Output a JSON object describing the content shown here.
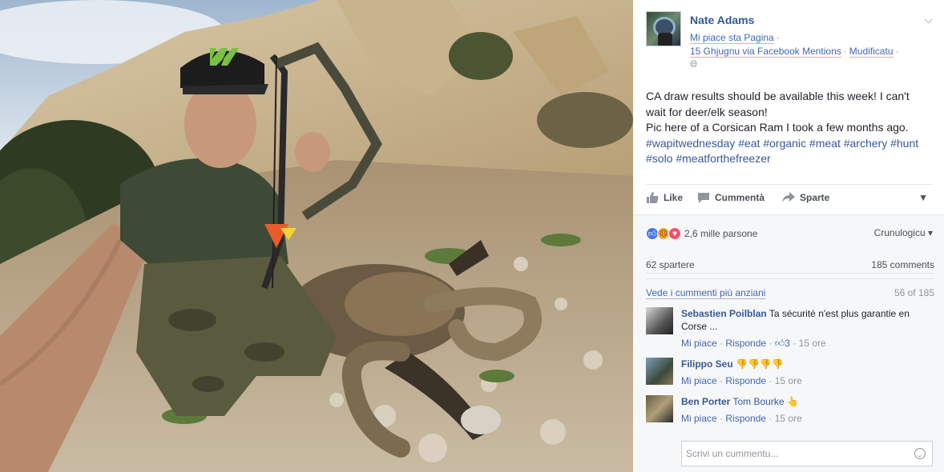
{
  "post": {
    "page_name": "Nate Adams",
    "liked_page": "Mi piace sta Pagina",
    "date_via": "15 Ghjugnu via Facebook Mentions",
    "edited": "Mudificatu",
    "text_lines": [
      "CA draw results should be available this week! I can't wait for deer/elk season!",
      "Pic here of a Corsican Ram I took a few months ago."
    ],
    "hashtags": [
      "#wapitwednesday",
      "#eat",
      "#organic",
      "#meat",
      "#archery",
      "#hunt",
      "#solo",
      "#meatforthefreezer"
    ]
  },
  "actions": {
    "like": "Like",
    "comment": "Cummentà",
    "share": "Sparte"
  },
  "reactions": {
    "count": "2,6 mille parsone",
    "sort": "Crunulogicu"
  },
  "counts": {
    "shares": "62 spartere",
    "comments": "185 comments"
  },
  "more": {
    "link": "Vede i cummenti più anziani",
    "count": "56 of 185"
  },
  "comments": [
    {
      "author": "Sebastien Poilblan",
      "text": "Ta sécurité n'est plus garantie en Corse ...",
      "like": "Mi piace",
      "reply": "Risponde",
      "likes": "3",
      "time": "15 ore"
    },
    {
      "author": "Filippo Seu",
      "text": "👎👎👎👎",
      "like": "Mi piace",
      "reply": "Risponde",
      "time": "15 ore"
    },
    {
      "author": "Ben Porter",
      "tag": "Tom Bourke",
      "text": "👆",
      "like": "Mi piace",
      "reply": "Risponde",
      "time": "15 ore"
    }
  ],
  "compose": {
    "placeholder": "Scrivi un cummentu..."
  },
  "colors": {
    "link": "#365899",
    "accent": "#4267b2",
    "muted": "#90949c"
  }
}
